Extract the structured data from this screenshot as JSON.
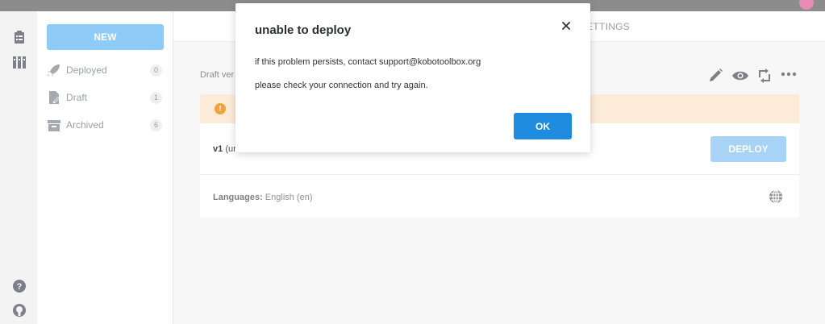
{
  "sidebar": {
    "new_label": "NEW",
    "items": [
      {
        "label": "Deployed",
        "count": "0",
        "icon": "rocket-icon"
      },
      {
        "label": "Draft",
        "count": "1",
        "icon": "draft-icon"
      },
      {
        "label": "Archived",
        "count": "6",
        "icon": "archive-icon"
      }
    ]
  },
  "leftrail": {
    "icons": [
      "clipboard-icon",
      "library-icon",
      "help-icon",
      "github-icon"
    ]
  },
  "tabs": {
    "settings_partial": "ETTINGS"
  },
  "form": {
    "draft_label": "Draft ver",
    "version": "v1",
    "version_detail": "(ur",
    "deploy_label": "DEPLOY",
    "languages_label": "Languages:",
    "languages_value": "English (en)"
  },
  "modal": {
    "title": "unable to deploy",
    "message1": "if this problem persists, contact support@kobotoolbox.org",
    "message2": "please check your connection and try again.",
    "ok_label": "OK"
  },
  "colors": {
    "primary": "#1f8bdf",
    "primary_light": "#8fcbf7",
    "warning_bg": "#fcebd9",
    "warning_icon": "#f0a33b"
  }
}
